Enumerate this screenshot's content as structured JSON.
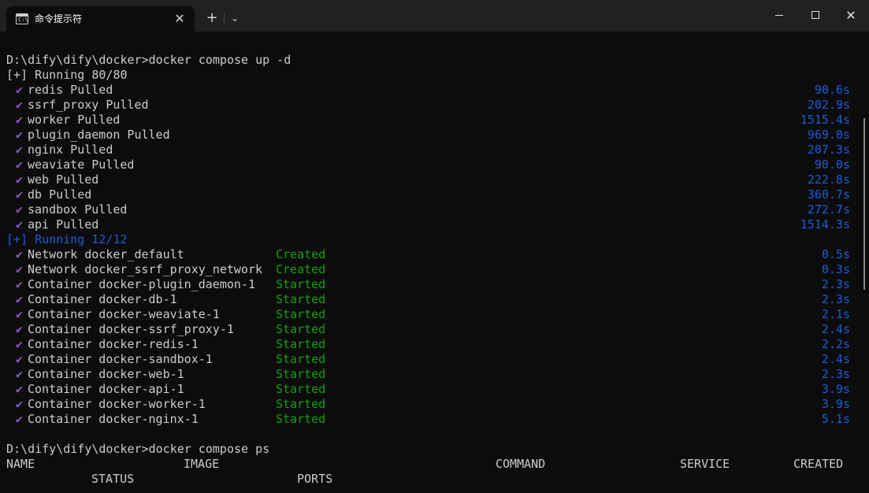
{
  "window": {
    "tab_title": "命令提示符",
    "tab_icon_glyph": "C:\\",
    "close_tab": "✕",
    "new_tab": "+",
    "dropdown": "⌄",
    "close_window": "✕"
  },
  "terminal": {
    "cmd1": "D:\\dify\\dify\\docker>docker compose up -d",
    "running1": "[+] Running 80/80",
    "pulls": [
      {
        "text": "redis Pulled",
        "time": "90.6s"
      },
      {
        "text": "ssrf_proxy Pulled",
        "time": "202.9s"
      },
      {
        "text": "worker Pulled",
        "time": "1515.4s"
      },
      {
        "text": "plugin_daemon Pulled",
        "time": "969.0s"
      },
      {
        "text": "nginx Pulled",
        "time": "207.3s"
      },
      {
        "text": "weaviate Pulled",
        "time": "90.0s"
      },
      {
        "text": "web Pulled",
        "time": "222.8s"
      },
      {
        "text": "db Pulled",
        "time": "360.7s"
      },
      {
        "text": "sandbox Pulled",
        "time": "272.7s"
      },
      {
        "text": "api Pulled",
        "time": "1514.3s"
      }
    ],
    "running2": "[+] Running 12/12",
    "containers": [
      {
        "text": "Network docker_default",
        "status": "Created",
        "time": "0.5s"
      },
      {
        "text": "Network docker_ssrf_proxy_network",
        "status": "Created",
        "time": "0.3s"
      },
      {
        "text": "Container docker-plugin_daemon-1",
        "status": "Started",
        "time": "2.3s"
      },
      {
        "text": "Container docker-db-1",
        "status": "Started",
        "time": "2.3s"
      },
      {
        "text": "Container docker-weaviate-1",
        "status": "Started",
        "time": "2.1s"
      },
      {
        "text": "Container docker-ssrf_proxy-1",
        "status": "Started",
        "time": "2.4s"
      },
      {
        "text": "Container docker-redis-1",
        "status": "Started",
        "time": "2.2s"
      },
      {
        "text": "Container docker-sandbox-1",
        "status": "Started",
        "time": "2.4s"
      },
      {
        "text": "Container docker-web-1",
        "status": "Started",
        "time": "2.3s"
      },
      {
        "text": "Container docker-api-1",
        "status": "Started",
        "time": "3.9s"
      },
      {
        "text": "Container docker-worker-1",
        "status": "Started",
        "time": "3.9s"
      },
      {
        "text": "Container docker-nginx-1",
        "status": "Started",
        "time": "5.1s"
      }
    ],
    "cmd2": "D:\\dify\\dify\\docker>docker compose ps",
    "ps_headers": {
      "name": "NAME",
      "image": "IMAGE",
      "command": "COMMAND",
      "service": "SERVICE",
      "created": "CREATED",
      "status": "STATUS",
      "ports": "PORTS"
    },
    "check_glyph": "✔"
  },
  "colors": {
    "background": "#0c0c0c",
    "text": "#cccccc",
    "check": "#8a5cc8",
    "green": "#13a10e",
    "blue": "#1f5bd6"
  }
}
